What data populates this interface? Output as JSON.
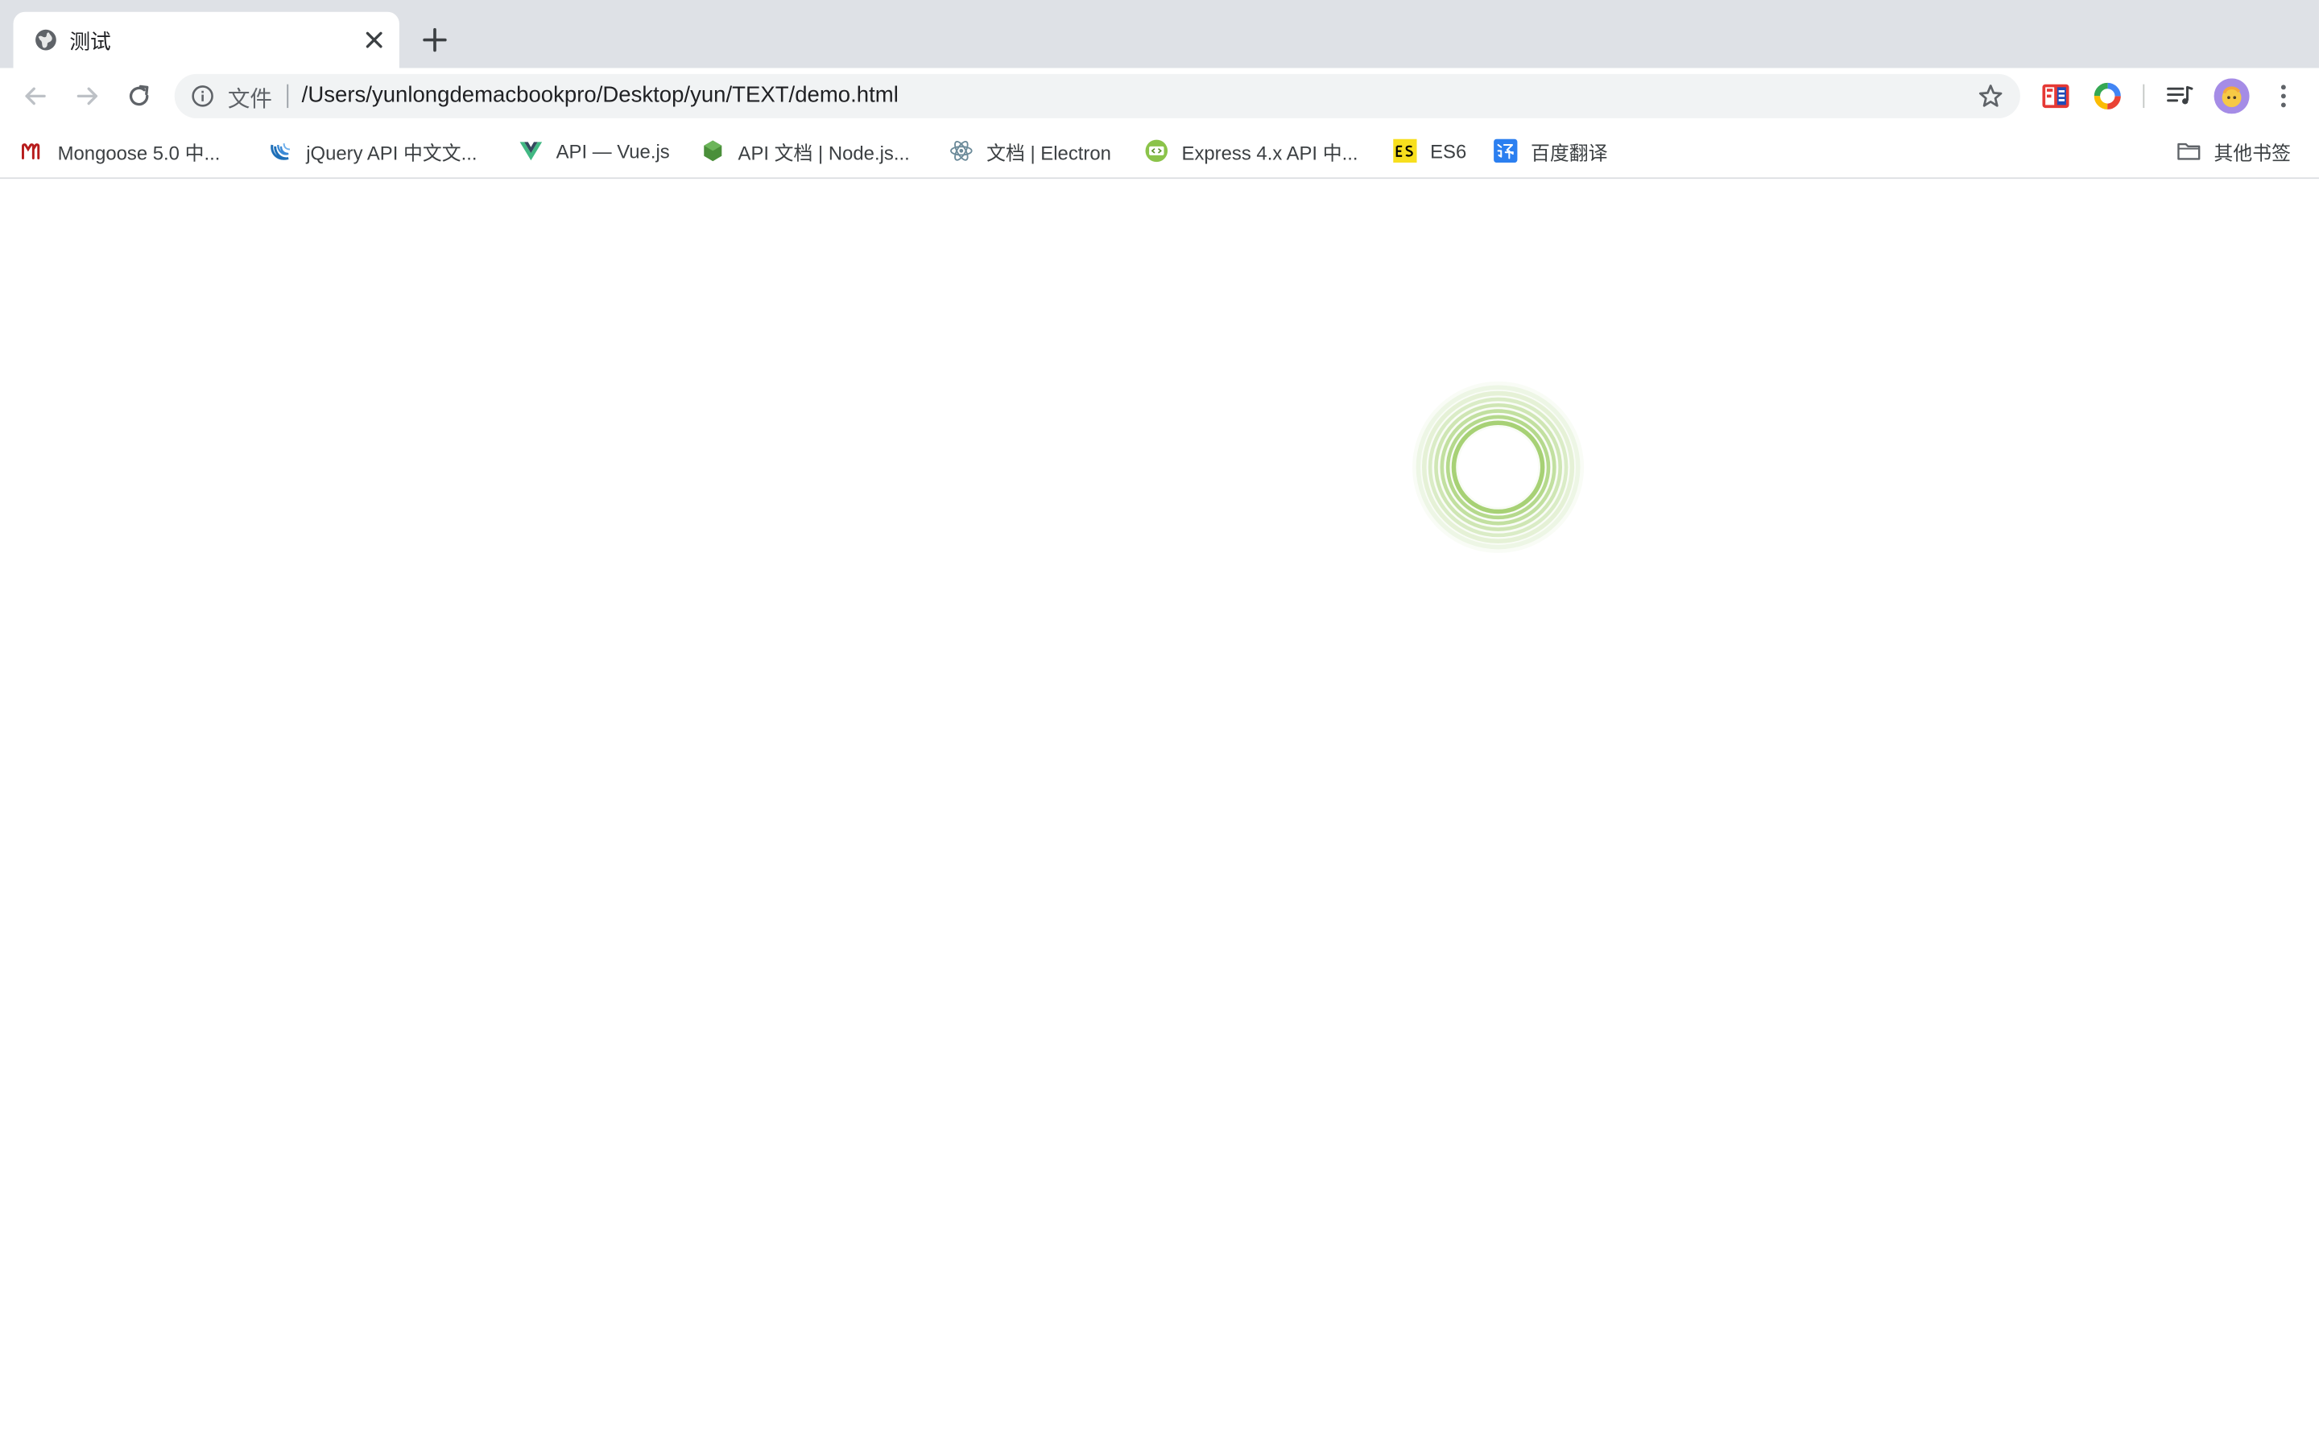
{
  "tab": {
    "title": "测试",
    "favicon": "globe-icon"
  },
  "toolbar": {
    "omnibox": {
      "scheme_label": "文件",
      "url": "/Users/yunlongdemacbookpro/Desktop/yun/TEXT/demo.html"
    }
  },
  "bookmarks": {
    "items": [
      {
        "label": "Mongoose 5.0 中...",
        "icon": "mongoose-icon",
        "color": "#b71c1c"
      },
      {
        "label": "jQuery API 中文文...",
        "icon": "jquery-icon",
        "color": "#1e6fb8"
      },
      {
        "label": "API — Vue.js",
        "icon": "vue-icon",
        "color": "#41b883"
      },
      {
        "label": "API 文档 | Node.js...",
        "icon": "nodejs-icon",
        "color": "#4a8f3a"
      },
      {
        "label": "文档 | Electron",
        "icon": "electron-icon",
        "color": "#6b8a99"
      },
      {
        "label": "Express 4.x API 中...",
        "icon": "express-icon",
        "color": "#8bc34a"
      },
      {
        "label": "ES6",
        "icon": "es6-icon",
        "color": "#f7df1e"
      },
      {
        "label": "百度翻译",
        "icon": "baidu-translate-icon",
        "color": "#2b7ff0"
      }
    ],
    "other": {
      "label": "其他书签",
      "icon": "folder-icon"
    }
  },
  "page": {
    "spinner": {
      "icon": "loading-ring-icon",
      "color": "#8bc34a"
    }
  }
}
